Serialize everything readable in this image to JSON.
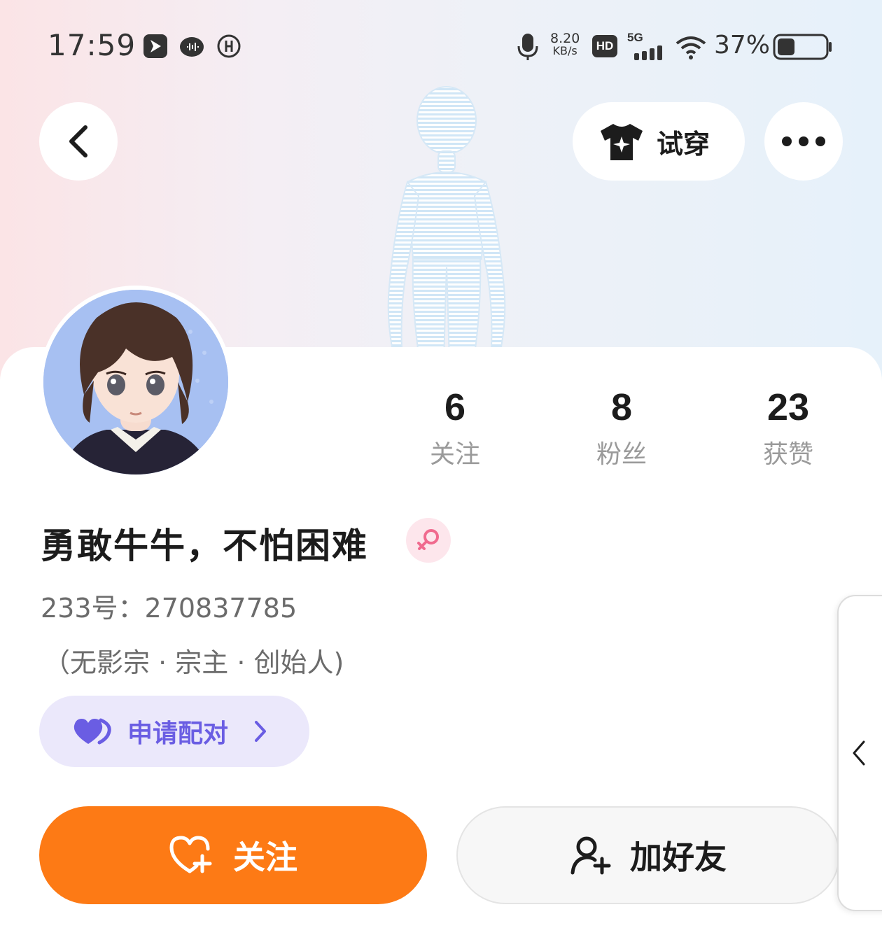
{
  "status_bar": {
    "time": "17:59",
    "net_speed_value": "8.20",
    "net_speed_unit": "KB/s",
    "hd_badge": "HD",
    "network": "5G",
    "battery_percent": "37%",
    "battery_level": 0.37
  },
  "header": {
    "back_icon": "chevron-left-icon",
    "try_on_label": "试穿",
    "try_on_icon": "tshirt-icon",
    "more_icon": "more-dots-icon"
  },
  "profile": {
    "username": "勇敢牛牛，不怕困难",
    "gender": "female",
    "id_line": "233号：270837785",
    "title_line": "（无影宗 · 宗主 · 创始人)"
  },
  "stats": [
    {
      "value": "6",
      "label": "关注"
    },
    {
      "value": "8",
      "label": "粉丝"
    },
    {
      "value": "23",
      "label": "获赞"
    }
  ],
  "pair_button": {
    "label": "申请配对"
  },
  "actions": {
    "follow_label": "关注",
    "add_friend_label": "加好友"
  },
  "colors": {
    "accent_orange": "#fd7a15",
    "pair_purple": "#6a5de3",
    "pair_bg": "#ebe8fb",
    "female_pink": "#f06a8e"
  }
}
